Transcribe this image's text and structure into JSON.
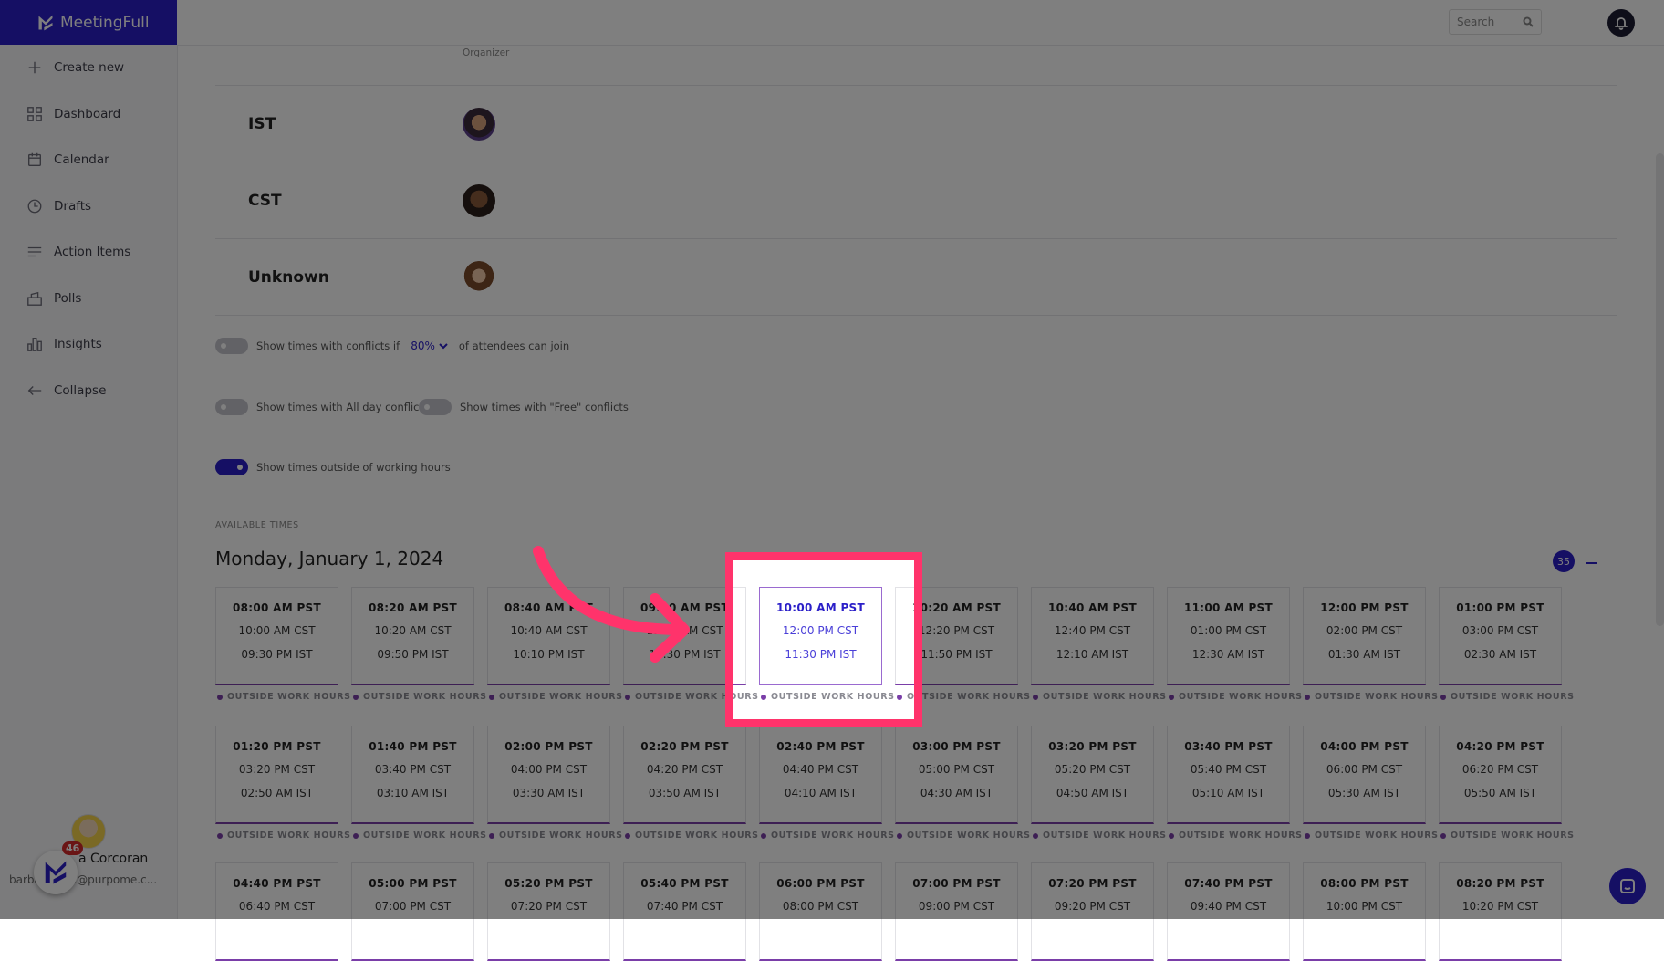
{
  "app": {
    "name": "MeetingFull",
    "brand_color": "#2b1fc8"
  },
  "sidebar": {
    "items": [
      {
        "label": "Create new",
        "icon": "plus-icon"
      },
      {
        "label": "Dashboard",
        "icon": "grid-icon"
      },
      {
        "label": "Calendar",
        "icon": "calendar-icon"
      },
      {
        "label": "Drafts",
        "icon": "clock-icon"
      },
      {
        "label": "Action Items",
        "icon": "list-icon"
      },
      {
        "label": "Polls",
        "icon": "ballot-icon"
      },
      {
        "label": "Insights",
        "icon": "bar-chart-icon"
      },
      {
        "label": "Collapse",
        "icon": "arrow-left-icon"
      }
    ],
    "user": {
      "name": "a Corcoran",
      "email": "barba…oran@purpome.c...",
      "notification_count": "46"
    }
  },
  "header": {
    "search_placeholder": "Search"
  },
  "attendees": {
    "organizer_label": "Organizer",
    "rows": [
      {
        "timezone": "IST"
      },
      {
        "timezone": "CST"
      },
      {
        "timezone": "Unknown"
      }
    ]
  },
  "options": {
    "conflicts_prefix": "Show times with conflicts if",
    "conflicts_percent": "80%",
    "conflicts_suffix": "of attendees can join",
    "conflicts_enabled": false,
    "all_day_label": "Show times with All day conflicts",
    "all_day_enabled": false,
    "free_label": "Show times with \"Free\" conflicts",
    "free_enabled": false,
    "outside_hours_label": "Show times outside of working hours",
    "outside_hours_enabled": true
  },
  "available": {
    "section_label": "AVAILABLE TIMES",
    "date": "Monday, January 1, 2024",
    "count": "35",
    "tag_label": "OUTSIDE WORK HOURS",
    "selected_index": 4,
    "slots": [
      {
        "pst": "08:00 AM PST",
        "cst": "10:00 AM CST",
        "ist": "09:30 PM IST"
      },
      {
        "pst": "08:20 AM PST",
        "cst": "10:20 AM CST",
        "ist": "09:50 PM IST"
      },
      {
        "pst": "08:40 AM PST",
        "cst": "10:40 AM CST",
        "ist": "10:10 PM IST"
      },
      {
        "pst": "09:00 AM PST",
        "cst": "11:00 AM CST",
        "ist": "10:30 PM IST"
      },
      {
        "pst": "10:00 AM PST",
        "cst": "12:00 PM CST",
        "ist": "11:30 PM IST"
      },
      {
        "pst": "10:20 AM PST",
        "cst": "12:20 PM CST",
        "ist": "11:50 PM IST"
      },
      {
        "pst": "10:40 AM PST",
        "cst": "12:40 PM CST",
        "ist": "12:10 AM IST"
      },
      {
        "pst": "11:00 AM PST",
        "cst": "01:00 PM CST",
        "ist": "12:30 AM IST"
      },
      {
        "pst": "12:00 PM PST",
        "cst": "02:00 PM CST",
        "ist": "01:30 AM IST"
      },
      {
        "pst": "01:00 PM PST",
        "cst": "03:00 PM CST",
        "ist": "02:30 AM IST"
      },
      {
        "pst": "01:20 PM PST",
        "cst": "03:20 PM CST",
        "ist": "02:50 AM IST"
      },
      {
        "pst": "01:40 PM PST",
        "cst": "03:40 PM CST",
        "ist": "03:10 AM IST"
      },
      {
        "pst": "02:00 PM PST",
        "cst": "04:00 PM CST",
        "ist": "03:30 AM IST"
      },
      {
        "pst": "02:20 PM PST",
        "cst": "04:20 PM CST",
        "ist": "03:50 AM IST"
      },
      {
        "pst": "02:40 PM PST",
        "cst": "04:40 PM CST",
        "ist": "04:10 AM IST"
      },
      {
        "pst": "03:00 PM PST",
        "cst": "05:00 PM CST",
        "ist": "04:30 AM IST"
      },
      {
        "pst": "03:20 PM PST",
        "cst": "05:20 PM CST",
        "ist": "04:50 AM IST"
      },
      {
        "pst": "03:40 PM PST",
        "cst": "05:40 PM CST",
        "ist": "05:10 AM IST"
      },
      {
        "pst": "04:00 PM PST",
        "cst": "06:00 PM CST",
        "ist": "05:30 AM IST"
      },
      {
        "pst": "04:20 PM PST",
        "cst": "06:20 PM CST",
        "ist": "05:50 AM IST"
      },
      {
        "pst": "04:40 PM PST",
        "cst": "06:40 PM CST",
        "ist": ""
      },
      {
        "pst": "05:00 PM PST",
        "cst": "07:00 PM CST",
        "ist": ""
      },
      {
        "pst": "05:20 PM PST",
        "cst": "07:20 PM CST",
        "ist": ""
      },
      {
        "pst": "05:40 PM PST",
        "cst": "07:40 PM CST",
        "ist": ""
      },
      {
        "pst": "06:00 PM PST",
        "cst": "08:00 PM CST",
        "ist": ""
      },
      {
        "pst": "07:00 PM PST",
        "cst": "09:00 PM CST",
        "ist": ""
      },
      {
        "pst": "07:20 PM PST",
        "cst": "09:20 PM CST",
        "ist": ""
      },
      {
        "pst": "07:40 PM PST",
        "cst": "09:40 PM CST",
        "ist": ""
      },
      {
        "pst": "08:00 PM PST",
        "cst": "10:00 PM CST",
        "ist": ""
      },
      {
        "pst": "08:20 PM PST",
        "cst": "10:20 PM CST",
        "ist": ""
      }
    ]
  },
  "overlay": {
    "highlight_color": "#ff336b"
  }
}
